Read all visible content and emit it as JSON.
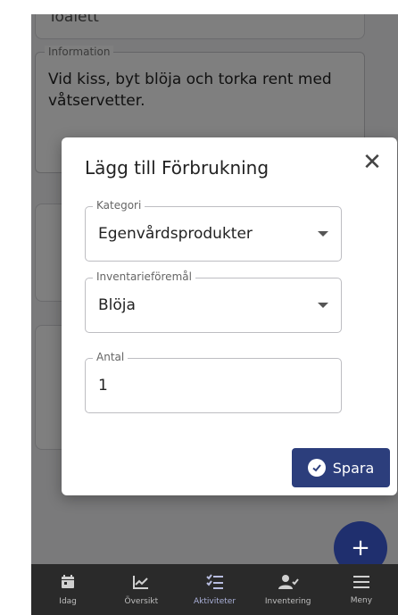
{
  "background": {
    "top_field_value": "Toalett",
    "information_label": "Information",
    "information_text": "Vid kiss, byt blöja och torka rent med våtservetter."
  },
  "dialog": {
    "title": "Lägg till Förbrukning",
    "category_label": "Kategori",
    "category_value": "Egenvårdsprodukter",
    "item_label": "Inventarieföremål",
    "item_value": "Blöja",
    "quantity_label": "Antal",
    "quantity_value": "1",
    "save_label": "Spara"
  },
  "fab_label": "+",
  "nav": {
    "items": [
      {
        "label": "Idag",
        "icon": "calendar-icon"
      },
      {
        "label": "Översikt",
        "icon": "chart-icon"
      },
      {
        "label": "Aktiviteter",
        "icon": "checklist-icon",
        "active": true
      },
      {
        "label": "Inventering",
        "icon": "person-check-icon"
      },
      {
        "label": "Meny",
        "icon": "menu-icon"
      }
    ]
  }
}
